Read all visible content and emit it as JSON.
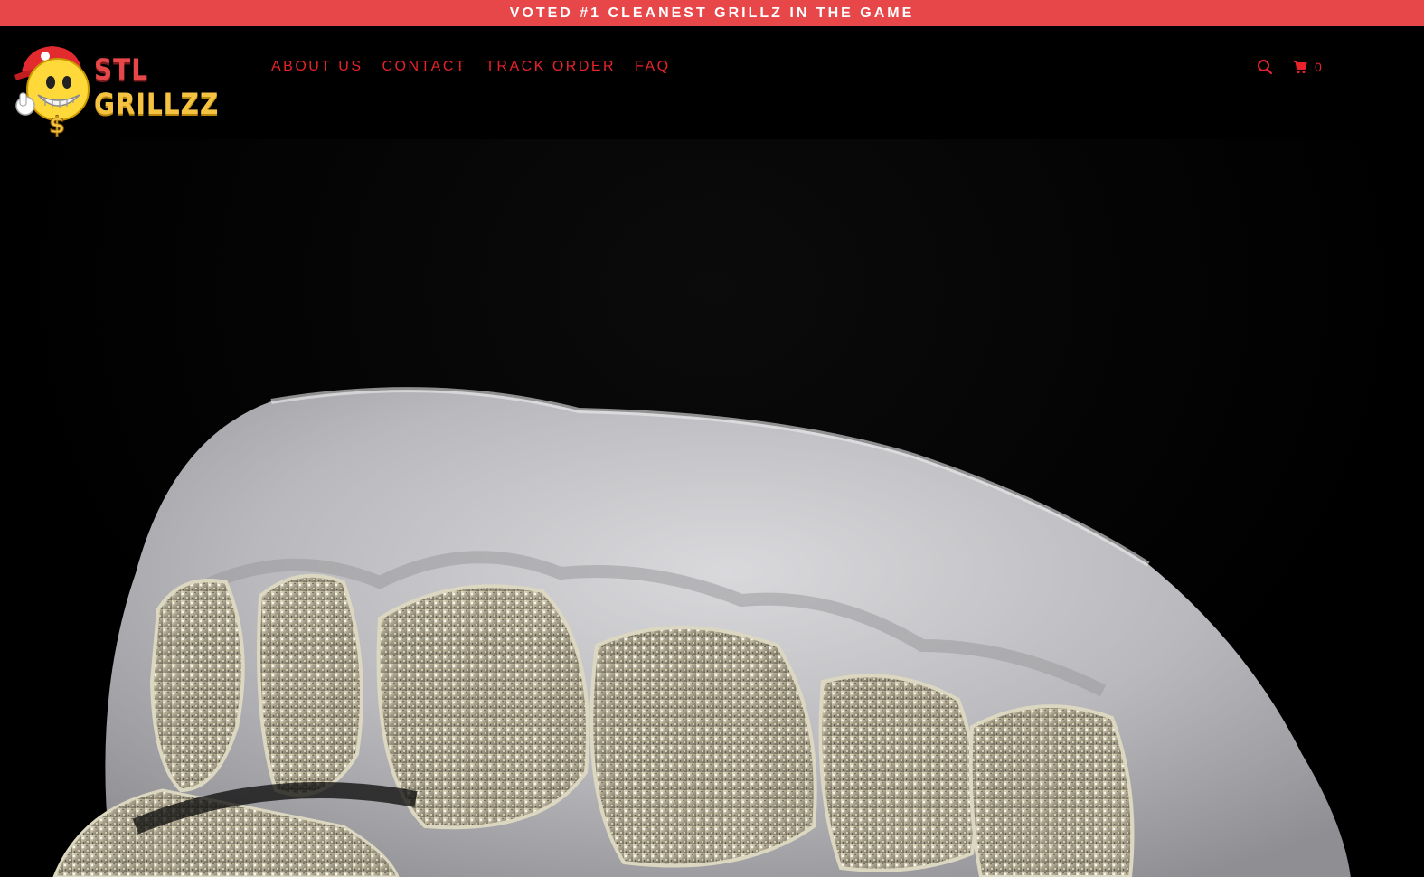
{
  "announcement": {
    "text": "VOTED #1 CLEANEST GRILLZ IN THE GAME",
    "background": "#e8474a",
    "color": "#ffffff"
  },
  "logo": {
    "text_stl": "STL",
    "text_grillzz": "GRILLZZ",
    "alt": "STL GRILLZZ"
  },
  "nav": {
    "items": [
      {
        "label": "ABOUT US"
      },
      {
        "label": "CONTACT"
      },
      {
        "label": "TRACK ORDER"
      },
      {
        "label": "FAQ"
      }
    ],
    "color": "#e8222a"
  },
  "tools": {
    "search_icon": "search-icon",
    "cart_icon": "cart-icon",
    "cart_count": "0"
  },
  "hero": {
    "image": "diamond-grillz-on-dental-mold"
  }
}
